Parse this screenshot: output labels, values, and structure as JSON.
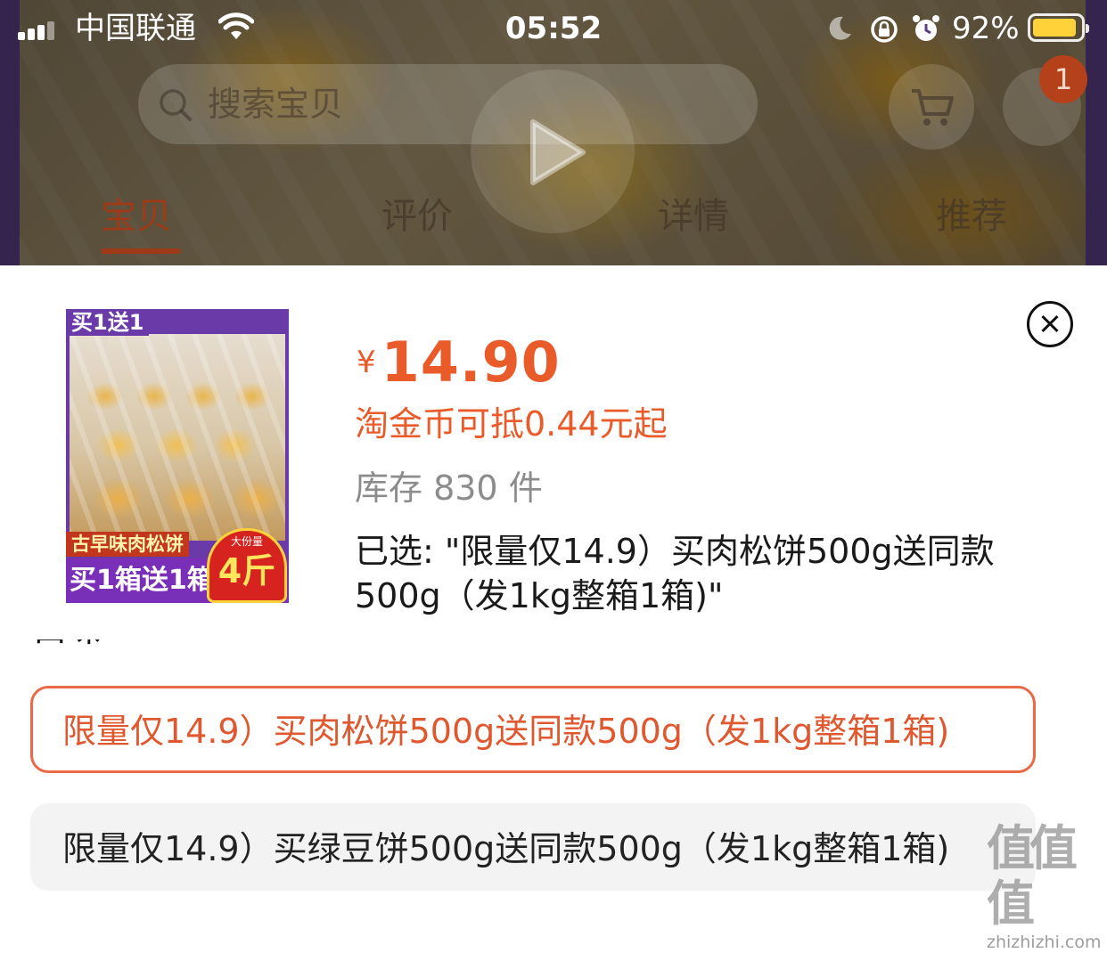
{
  "status_bar": {
    "carrier": "中国联通",
    "time": "05:52",
    "battery_percent": "92%",
    "battery_level": 0.92,
    "icons": [
      "signal-icon",
      "wifi-icon",
      "moon-icon",
      "rotation-lock-icon",
      "alarm-icon",
      "battery-icon"
    ]
  },
  "background_page": {
    "search_placeholder": "搜索宝贝",
    "cart_count": "1",
    "tabs": [
      {
        "label": "宝贝",
        "active": true
      },
      {
        "label": "评价",
        "active": false
      },
      {
        "label": "详情",
        "active": false
      },
      {
        "label": "推荐",
        "active": false
      }
    ]
  },
  "sheet": {
    "product_image": {
      "top_tag": "买1送1",
      "name_tag": "古早味肉松饼",
      "promo": "买1箱送1箱",
      "badge_small": "大份量",
      "badge_big": "4斤"
    },
    "currency": "¥",
    "price": "14.90",
    "coin_deduction": "淘金币可抵0.44元起",
    "stock": "库存 830 件",
    "selected": "已选: \"限量仅14.9）买肉松饼500g送同款500g（发1kg整箱1箱)\"",
    "section_label": "口味",
    "options": [
      {
        "label": "限量仅14.9）买肉松饼500g送同款500g（发1kg整箱1箱)",
        "selected": true
      },
      {
        "label": "限量仅14.9）买绿豆饼500g送同款500g（发1kg整箱1箱)",
        "selected": false
      }
    ]
  },
  "watermark": {
    "logo": "值值值",
    "url": "zhizhizhi.com"
  },
  "colors": {
    "accent": "#ea5b2a",
    "option_border": "#e96a45",
    "option_bg": "#f3f3f3"
  }
}
